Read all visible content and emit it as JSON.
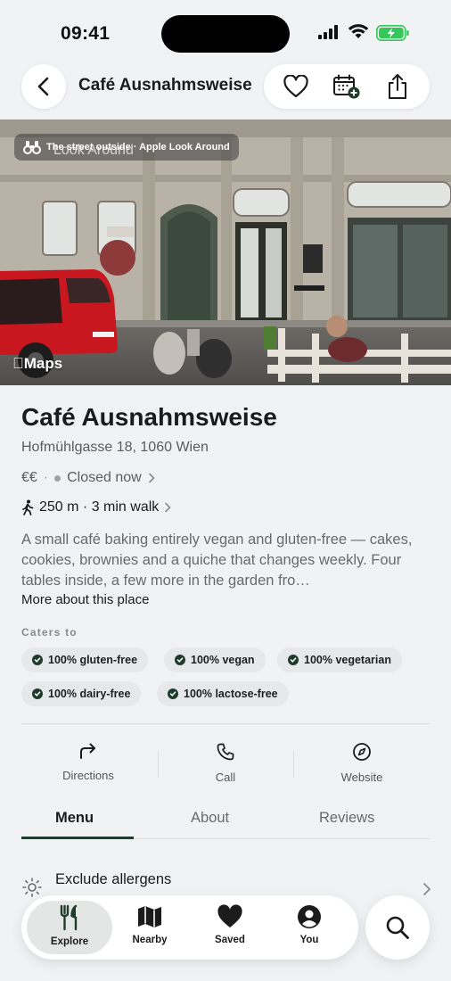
{
  "status_bar": {
    "time": "09:41"
  },
  "header": {
    "title": "Café Ausnahmsweise",
    "back_icon": "chevron-left-icon",
    "actions": [
      "heart-icon",
      "calendar-add-icon",
      "share-icon"
    ]
  },
  "hero": {
    "chip_title": "The street outside · Apple Look Around",
    "chip_sub": "Look Around",
    "watermark": "Maps"
  },
  "place": {
    "name": "Café Ausnahmsweise",
    "address": "Hofmühlgasse 18, 1060 Wien",
    "price": "€€",
    "status": "Closed now",
    "walk": "250 m · 3 min walk",
    "description": "A small café baking entirely vegan and gluten-free — cakes, cookies, brownies and a quiche that changes weekly. Four tables inside, a few more in the garden fro…",
    "more_link": "More about this place"
  },
  "caters": {
    "label": "Caters to",
    "tags": [
      "100% gluten-free",
      "100% vegan",
      "100% vegetarian",
      "100% dairy-free",
      "100% lactose-free"
    ]
  },
  "quick_actions": [
    {
      "label": "Directions",
      "icon": "arrow-turn-right-icon"
    },
    {
      "label": "Call",
      "icon": "phone-icon"
    },
    {
      "label": "Website",
      "icon": "compass-icon"
    }
  ],
  "tabs": [
    {
      "label": "Menu",
      "active": true
    },
    {
      "label": "About",
      "active": false
    },
    {
      "label": "Reviews",
      "active": false
    }
  ],
  "allergen_row": {
    "label": "Exclude allergens",
    "icon": "sun-settings-icon"
  },
  "bottom_nav": [
    {
      "label": "Explore",
      "icon": "fork-knife-icon",
      "active": true
    },
    {
      "label": "Nearby",
      "icon": "map-icon",
      "active": false
    },
    {
      "label": "Saved",
      "icon": "heart-filled-icon",
      "active": false
    },
    {
      "label": "You",
      "icon": "person-circle-icon",
      "active": false
    }
  ],
  "colors": {
    "accent": "#1e3b2c",
    "background": "#f1f2f4"
  }
}
